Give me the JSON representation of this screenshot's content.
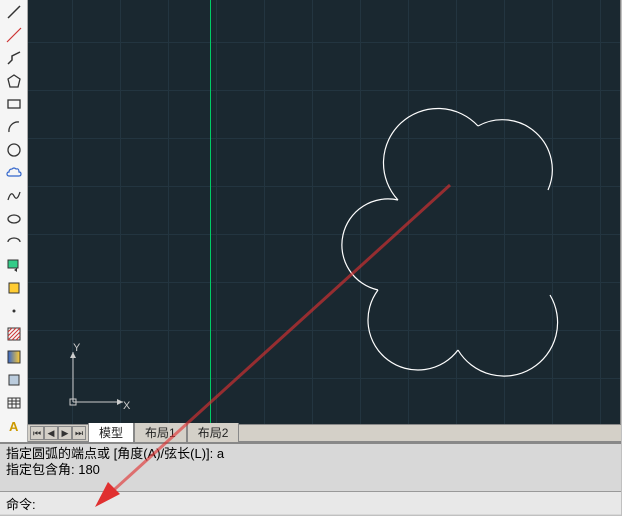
{
  "toolbar": {
    "tools": [
      {
        "name": "line-tool",
        "icon": "line"
      },
      {
        "name": "construction-line-tool",
        "icon": "xline"
      },
      {
        "name": "polyline-tool",
        "icon": "pline"
      },
      {
        "name": "polygon-tool",
        "icon": "polygon"
      },
      {
        "name": "rectangle-tool",
        "icon": "rect"
      },
      {
        "name": "arc-tool",
        "icon": "arc"
      },
      {
        "name": "circle-tool",
        "icon": "circle"
      },
      {
        "name": "revision-cloud-tool",
        "icon": "cloud"
      },
      {
        "name": "spline-tool",
        "icon": "spline"
      },
      {
        "name": "ellipse-tool",
        "icon": "ellipse"
      },
      {
        "name": "ellipse-arc-tool",
        "icon": "earc"
      },
      {
        "name": "insert-block-tool",
        "icon": "insert"
      },
      {
        "name": "make-block-tool",
        "icon": "block"
      },
      {
        "name": "point-tool",
        "icon": "point"
      },
      {
        "name": "hatch-tool",
        "icon": "hatch"
      },
      {
        "name": "gradient-tool",
        "icon": "gradient"
      },
      {
        "name": "region-tool",
        "icon": "region"
      },
      {
        "name": "table-tool",
        "icon": "table"
      },
      {
        "name": "text-tool",
        "icon": "text"
      }
    ]
  },
  "ucs": {
    "x_label": "X",
    "y_label": "Y"
  },
  "tabs": {
    "items": [
      {
        "label": "模型",
        "active": true
      },
      {
        "label": "布局1",
        "active": false
      },
      {
        "label": "布局2",
        "active": false
      }
    ]
  },
  "command": {
    "history_line1": "指定圆弧的端点或 [角度(A)/弦长(L)]: a",
    "history_line2": "指定包含角: 180",
    "prompt": "命令:",
    "input_value": ""
  },
  "colors": {
    "canvas_bg": "#1a2830",
    "grid": "#233540",
    "drawing": "#ffffff",
    "green_guide": "#00cc66",
    "ucs": "#cccccc",
    "arrow": "#e03030"
  }
}
